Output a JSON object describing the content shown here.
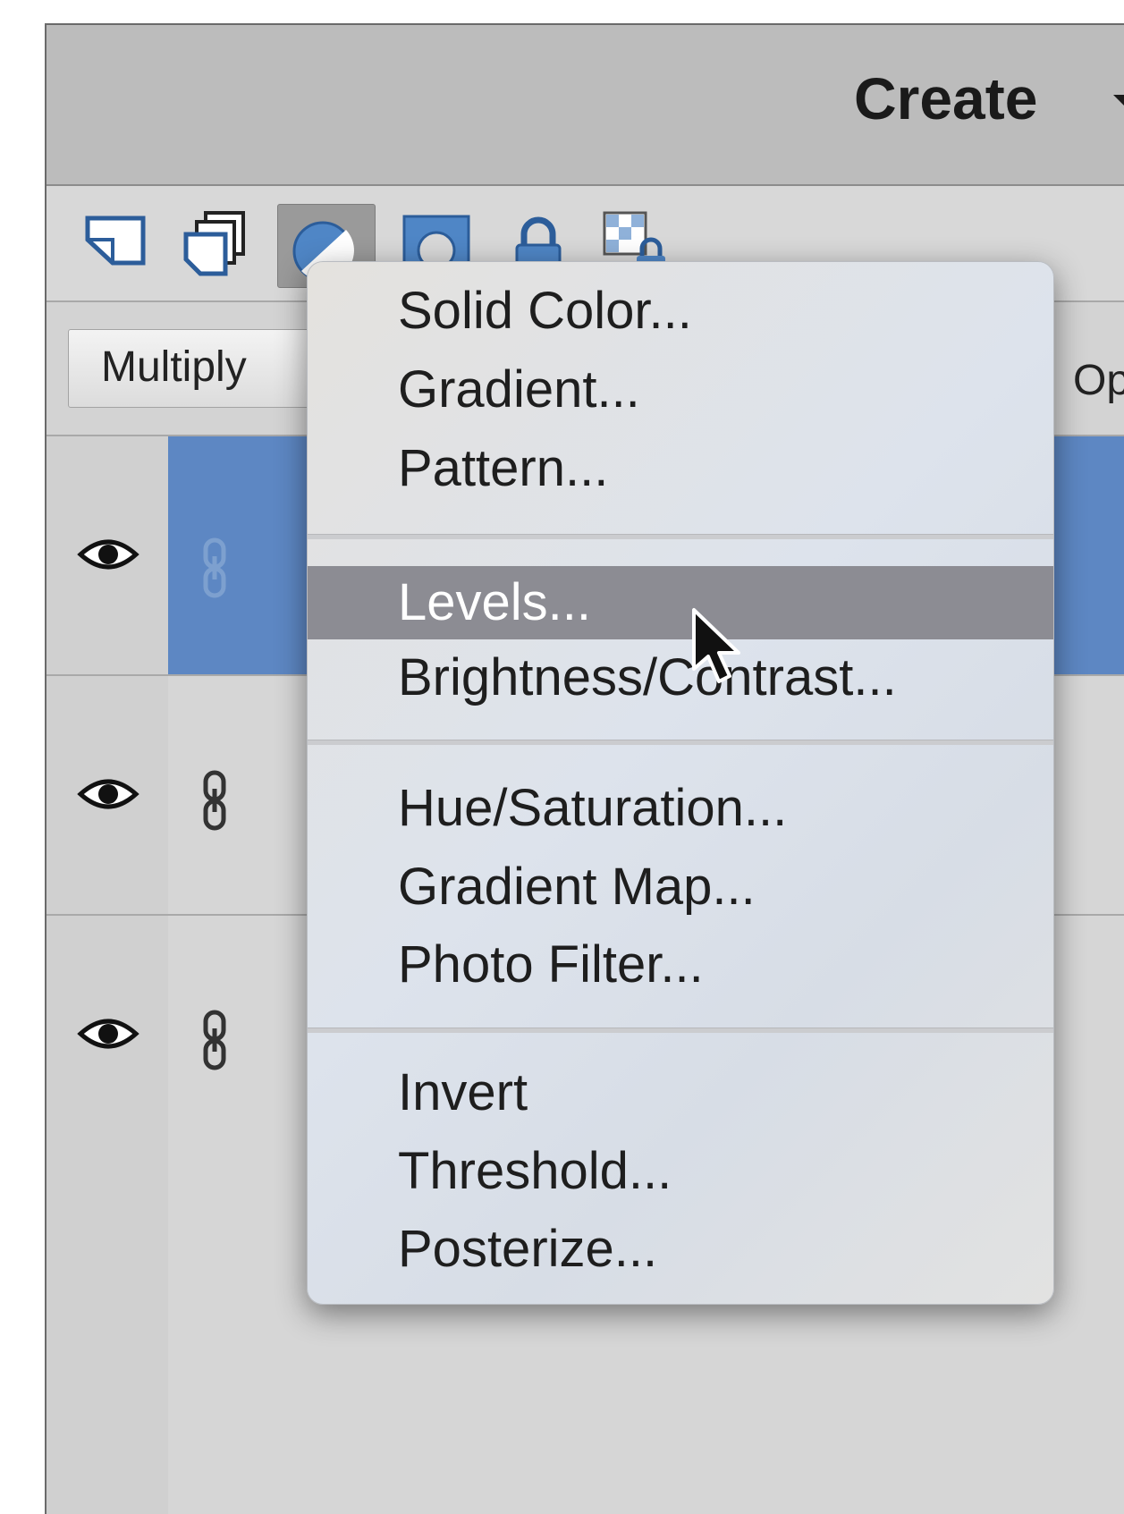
{
  "header": {
    "title": "Create",
    "dropdown_icon": "triangle-down-icon"
  },
  "toolbar": {
    "tools": [
      {
        "name": "new-layer-icon"
      },
      {
        "name": "new-group-icon"
      },
      {
        "name": "adjustment-layer-icon",
        "active": true
      },
      {
        "name": "layer-mask-icon"
      },
      {
        "name": "lock-icon"
      },
      {
        "name": "lock-transparency-icon"
      }
    ]
  },
  "blend": {
    "mode": "Multiply",
    "opacity_label": "Op"
  },
  "layers": [
    {
      "visible": true,
      "selected": true
    },
    {
      "visible": true,
      "selected": false
    },
    {
      "visible": true,
      "selected": false
    }
  ],
  "menu": {
    "groups": [
      [
        "Solid Color...",
        "Gradient...",
        "Pattern..."
      ],
      [
        "Levels...",
        "Brightness/Contrast..."
      ],
      [
        "Hue/Saturation...",
        "Gradient Map...",
        "Photo Filter..."
      ],
      [
        "Invert",
        "Threshold...",
        "Posterize..."
      ]
    ],
    "highlighted": "Levels..."
  },
  "colors": {
    "selected_layer": "#5d87c3",
    "menu_highlight": "#8c8c93",
    "tool_accent_blue": "#4f86c6"
  }
}
